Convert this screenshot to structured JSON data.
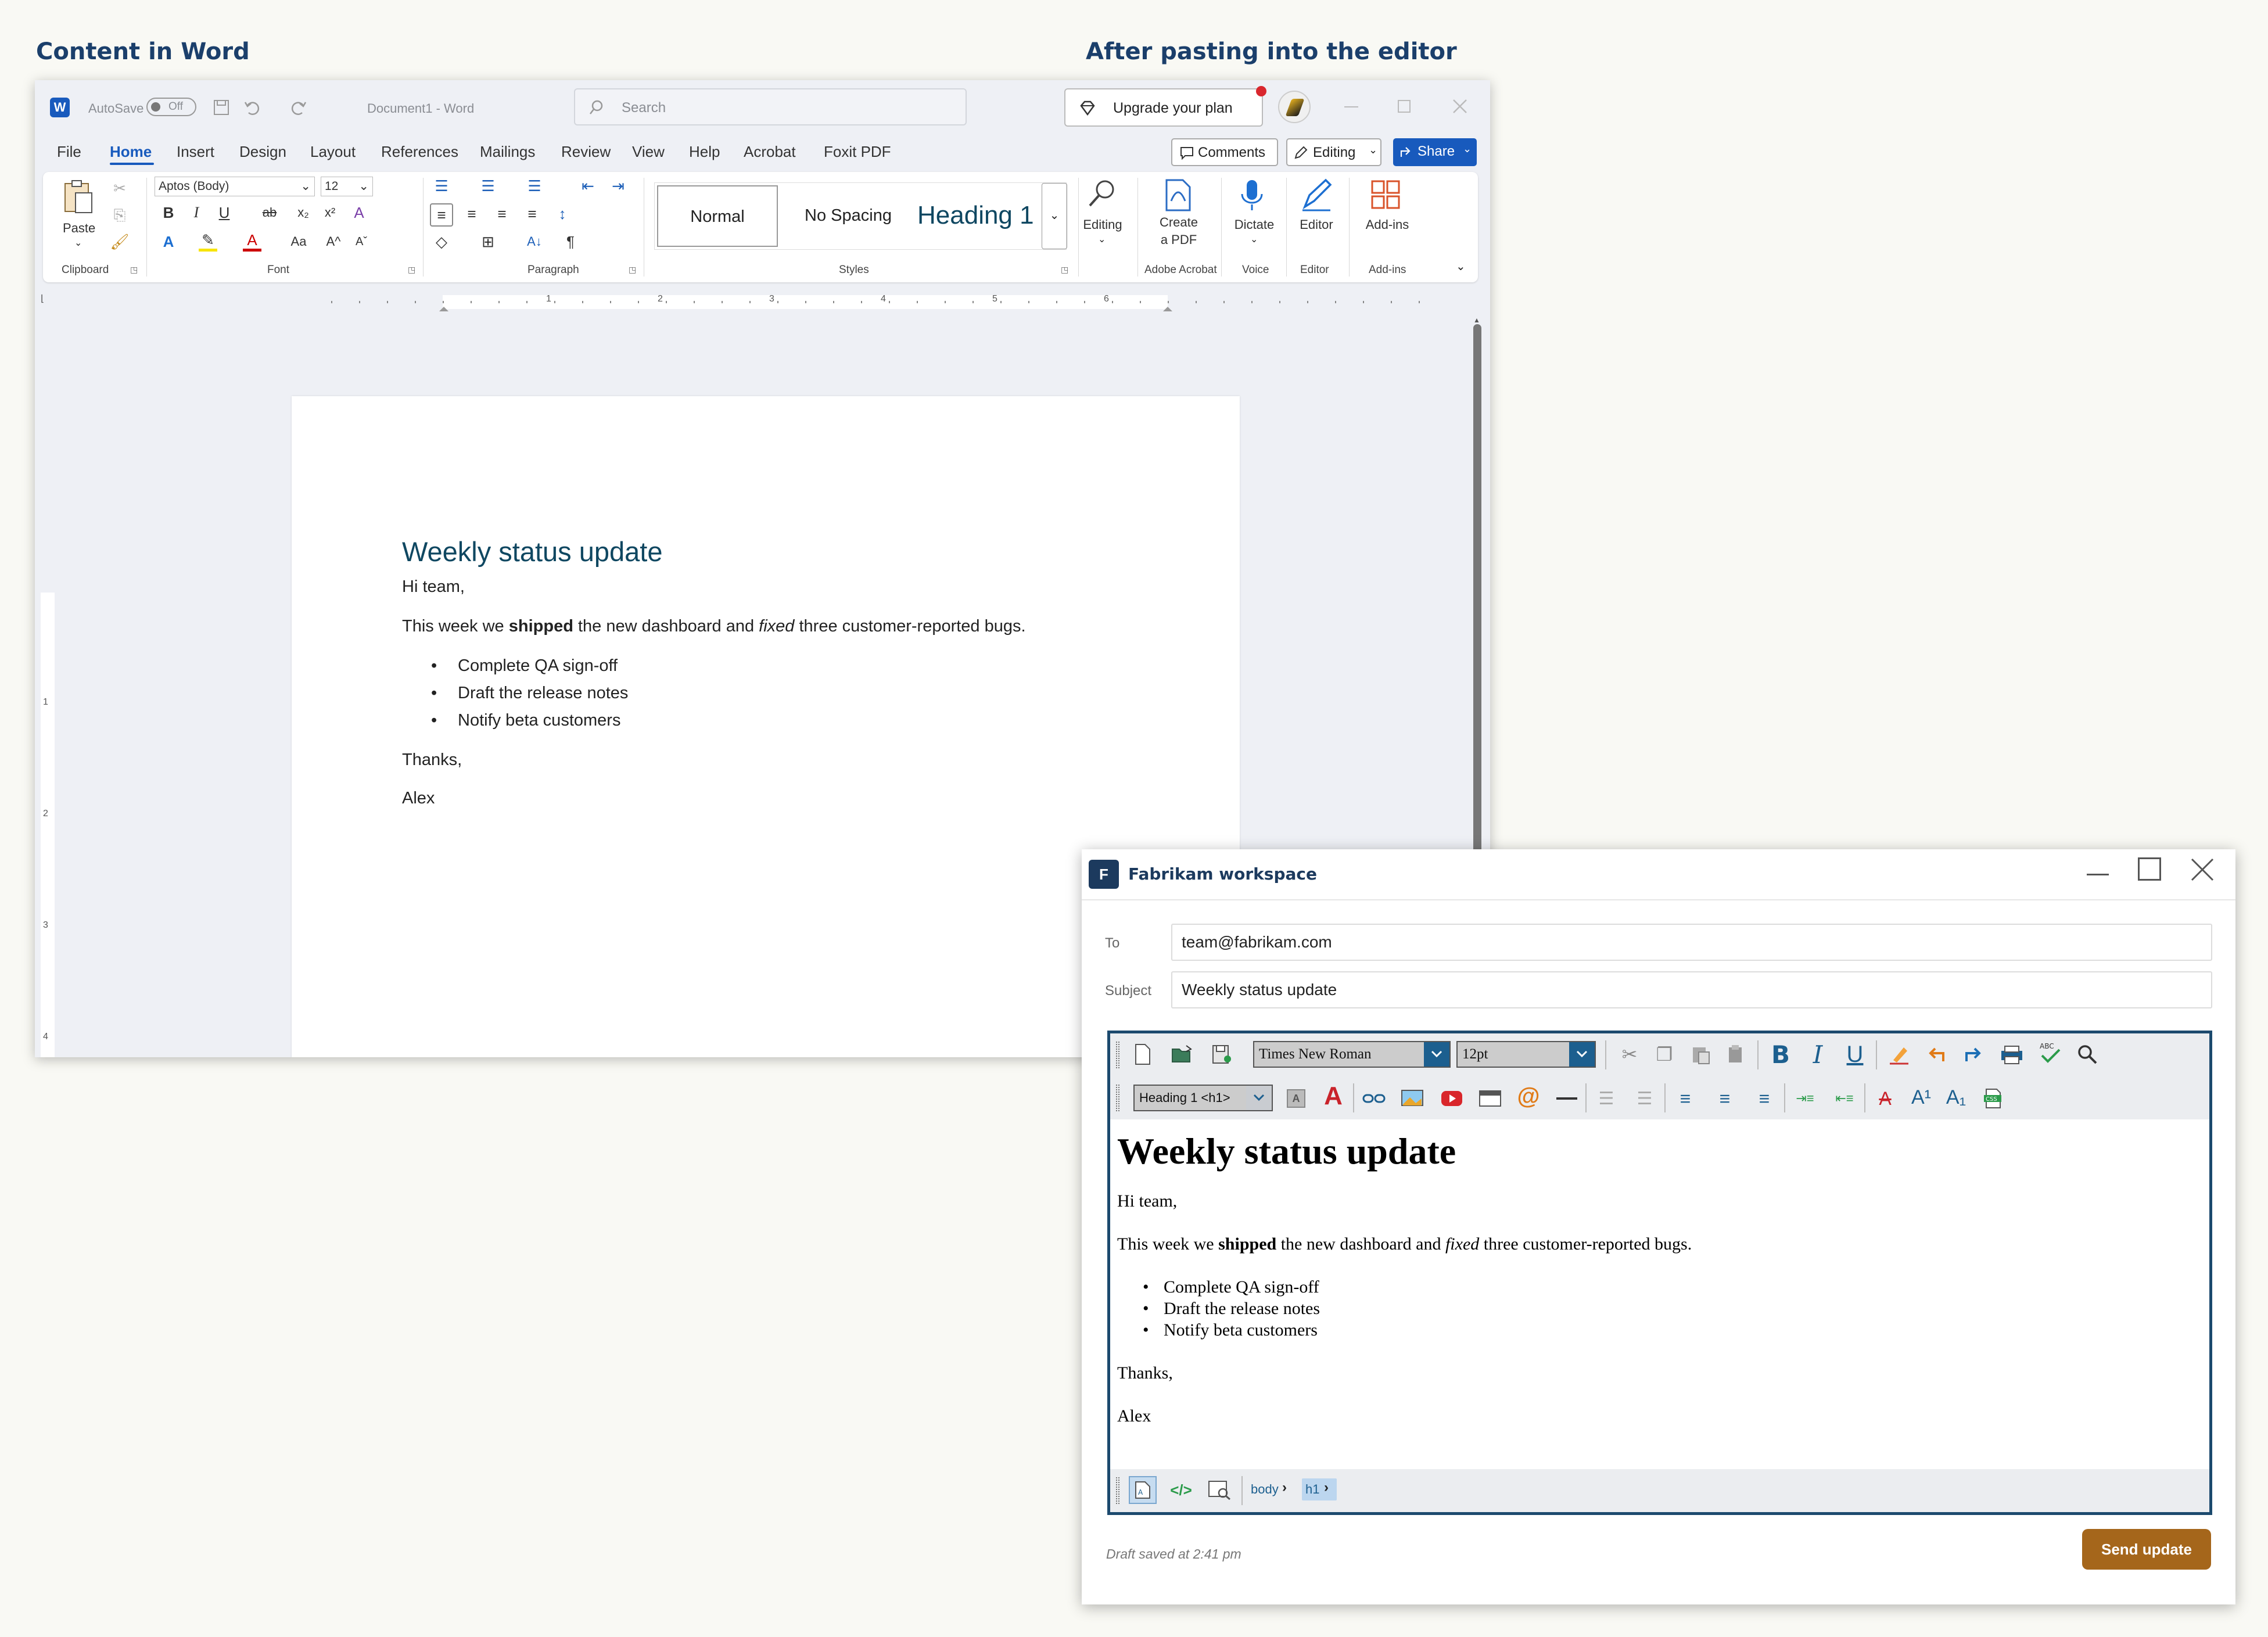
{
  "captions": {
    "left": "Content in Word",
    "right": "After pasting into the editor"
  },
  "word": {
    "titlebar": {
      "autosave": "AutoSave",
      "autosave_state": "Off",
      "doc_title": "Document1  -  Word",
      "search_placeholder": "Search",
      "upgrade": "Upgrade your plan"
    },
    "tabs": [
      "File",
      "Home",
      "Insert",
      "Design",
      "Layout",
      "References",
      "Mailings",
      "Review",
      "View",
      "Help",
      "Acrobat",
      "Foxit PDF"
    ],
    "active_tab": "Home",
    "actions": {
      "comments": "Comments",
      "editing": "Editing",
      "share": "Share"
    },
    "ribbon": {
      "paste": "Paste",
      "font_name": "Aptos (Body)",
      "font_size": "12",
      "styles": [
        "Normal",
        "No Spacing",
        "Heading 1"
      ],
      "editing": "Editing",
      "create_pdf": "Create\na PDF",
      "dictate": "Dictate",
      "editor": "Editor",
      "addins": "Add-ins",
      "groups": [
        "Clipboard",
        "Font",
        "Paragraph",
        "Styles",
        "Adobe Acrobat",
        "Voice",
        "Editor",
        "Add-ins"
      ]
    },
    "ruler_numbers": [
      "1",
      "2",
      "3",
      "4",
      "5",
      "6"
    ],
    "vruler_numbers": [
      "1",
      "2",
      "3",
      "4"
    ],
    "doc": {
      "heading": "Weekly status update",
      "greeting": "Hi team,",
      "p_before": "This week we ",
      "p_bold": "shipped",
      "p_mid": " the new dashboard and ",
      "p_italic": "fixed",
      "p_after": " three customer-reported bugs.",
      "bullets": [
        "Complete QA sign-off",
        "Draft the release notes",
        "Notify beta customers"
      ],
      "thanks": "Thanks,",
      "signoff": "Alex"
    }
  },
  "fabrikam": {
    "logo": "F",
    "title": "Fabrikam workspace",
    "to_label": "To",
    "to_value": "team@fabrikam.com",
    "subject_label": "Subject",
    "subject_value": "Weekly status update",
    "toolbar": {
      "font": "Times New Roman",
      "size": "12pt",
      "format": "Heading 1 <h1>"
    },
    "breadcrumb": [
      "body",
      "h1"
    ],
    "status": "Draft saved at 2:41 pm",
    "send": "Send update"
  },
  "colors": {
    "word_blue": "#185abd",
    "heading_blue": "#0f4761",
    "editor_border": "#1c4a6e",
    "send_button": "#a5661b"
  }
}
